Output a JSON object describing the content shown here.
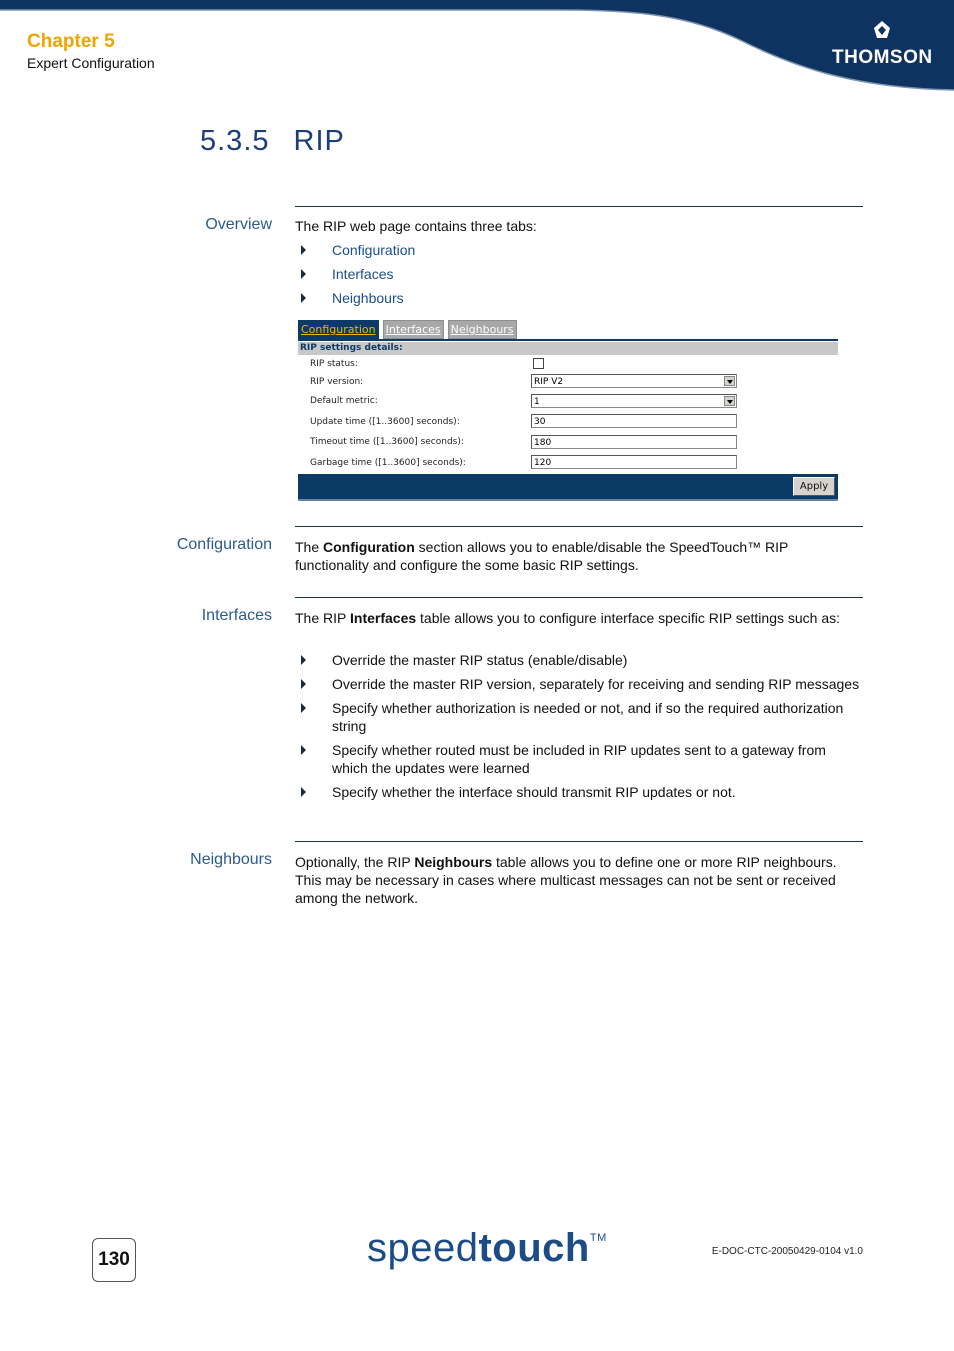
{
  "header": {
    "chapter": "Chapter 5",
    "chapter_title": "Expert Configuration",
    "brand_logo_text": "THOMSON",
    "colors": {
      "navy": "#0e3360",
      "chapter_orange": "#f0a400"
    }
  },
  "section": {
    "number": "5.3.5",
    "title": "RIP"
  },
  "overview": {
    "label": "Overview",
    "intro": "The RIP web page contains three tabs:",
    "tabs_list": [
      "Configuration",
      "Interfaces",
      "Neighbours"
    ]
  },
  "ui_screenshot": {
    "tabs": [
      {
        "label": "Configuration",
        "active": true
      },
      {
        "label": "Interfaces",
        "active": false
      },
      {
        "label": "Neighbours",
        "active": false
      }
    ],
    "panel_header": "RIP settings details:",
    "rows": [
      {
        "label": "RIP status:",
        "type": "checkbox",
        "checked": false
      },
      {
        "label": "RIP version:",
        "type": "select",
        "value": "RIP V2"
      },
      {
        "label": "Default metric:",
        "type": "select",
        "value": "1"
      },
      {
        "label": "Update time ([1..3600] seconds):",
        "type": "text",
        "value": "30"
      },
      {
        "label": "Timeout time ([1..3600] seconds):",
        "type": "text",
        "value": "180"
      },
      {
        "label": "Garbage time ([1..3600] seconds):",
        "type": "text",
        "value": "120"
      }
    ],
    "apply_label": "Apply"
  },
  "configuration": {
    "label": "Configuration",
    "text_pre": "The ",
    "text_bold": "Configuration",
    "text_post": " section allows you to enable/disable the SpeedTouch™ RIP functionality and configure the some basic RIP settings."
  },
  "interfaces": {
    "label": "Interfaces",
    "text_pre": "The RIP ",
    "text_bold": "Interfaces",
    "text_post": " table allows you to configure interface specific RIP settings such as:",
    "bullets": [
      "Override the master RIP status (enable/disable)",
      "Override the master RIP version, separately for receiving and sending RIP messages",
      "Specify whether authorization is needed or not, and if so the required authorization string",
      "Specify whether routed must be included in RIP updates sent to a gateway from which the updates were learned",
      "Specify whether the interface should transmit RIP updates or not."
    ]
  },
  "neighbours": {
    "label": "Neighbours",
    "text_pre": "Optionally, the RIP ",
    "text_bold": "Neighbours",
    "text_post": " table allows you to define one or more RIP neighbours. This may be necessary in cases where multicast messages can not be sent or received among the network."
  },
  "footer": {
    "page_number": "130",
    "logo_light": "speed",
    "logo_bold": "touch",
    "logo_tm": "TM",
    "doc_ref": "E-DOC-CTC-20050429-0104 v1.0"
  }
}
